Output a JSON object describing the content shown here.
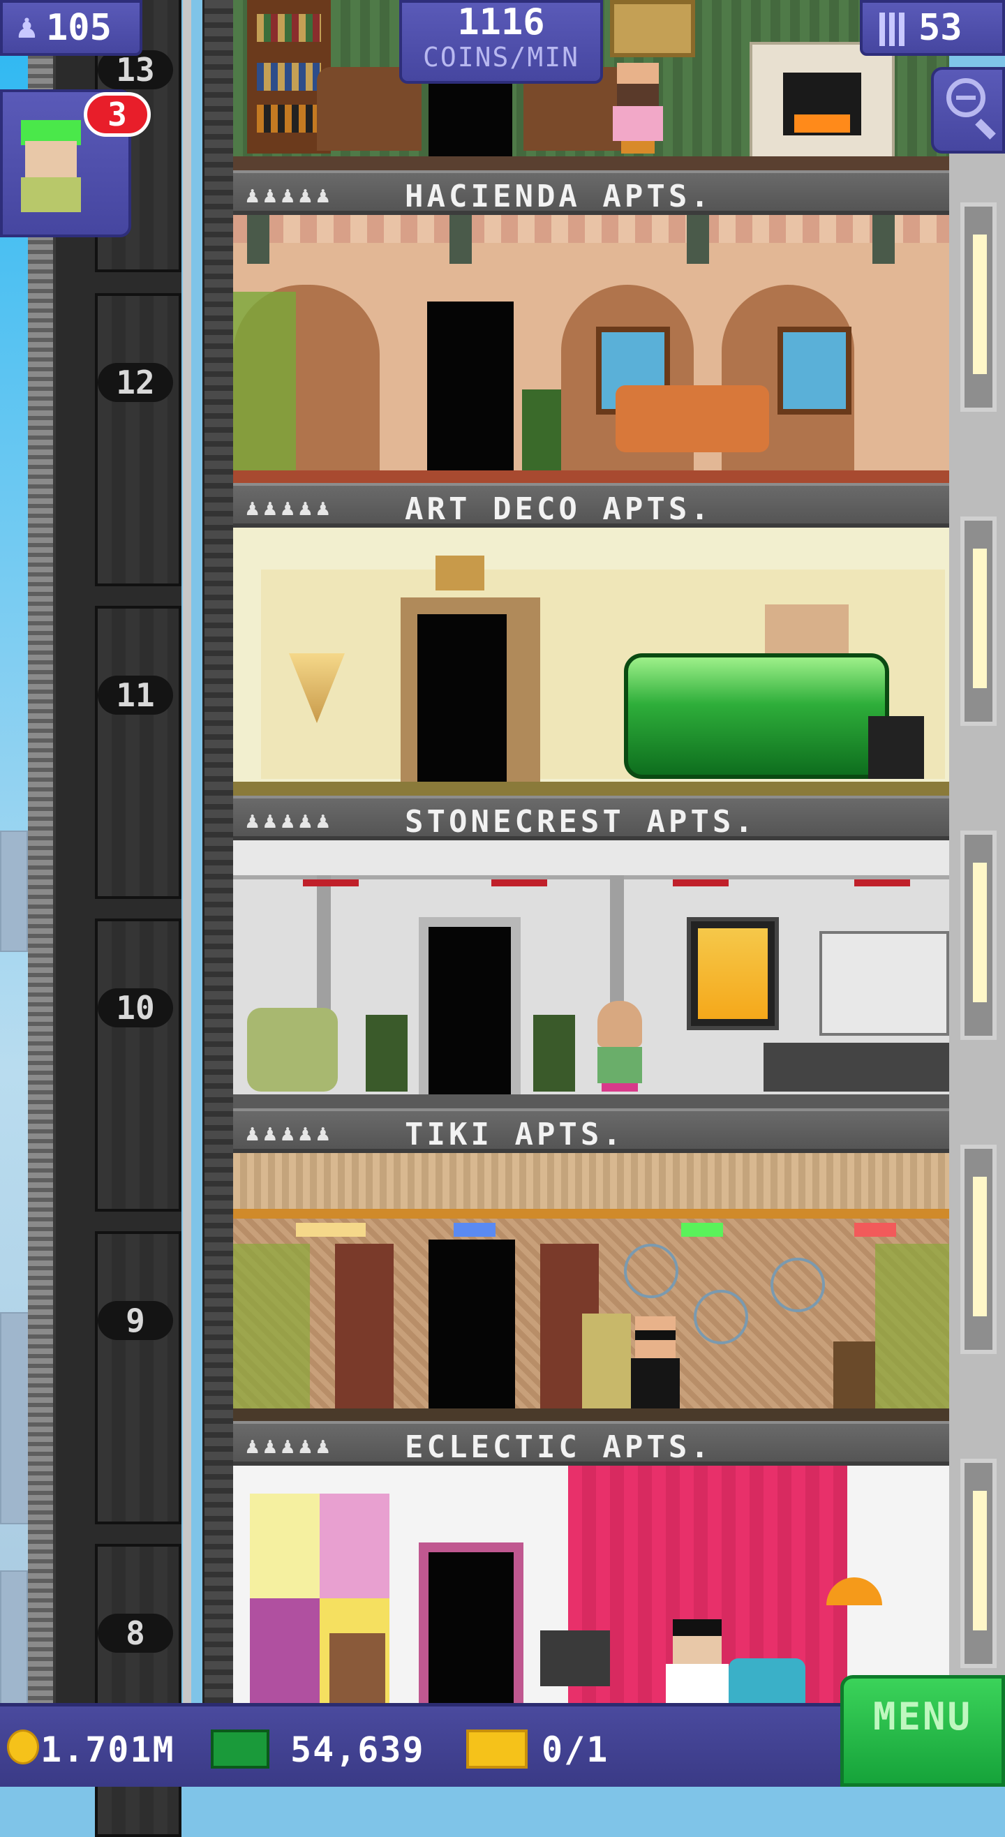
{
  "hud": {
    "population": "105",
    "coins_per_min_value": "1116",
    "coins_per_min_unit": "COINS/MIN",
    "floors_count": "53",
    "notification_count": "3"
  },
  "elevator": {
    "floor_numbers": [
      "13",
      "12",
      "11",
      "10",
      "9",
      "8"
    ]
  },
  "floors": [
    {
      "name": "HACIENDA APTS."
    },
    {
      "name": "ART DECO APTS."
    },
    {
      "name": "STONECREST APTS."
    },
    {
      "name": "TIKI APTS."
    },
    {
      "name": "ECLECTIC APTS."
    }
  ],
  "bottom_bar": {
    "coins": "1.701M",
    "bux": "54,639",
    "tickets": "0/1",
    "menu_label": "MENU"
  },
  "icons": [
    "person-icon",
    "building-icon",
    "zoom-out-icon",
    "coin-icon",
    "bux-icon",
    "ticket-icon"
  ]
}
